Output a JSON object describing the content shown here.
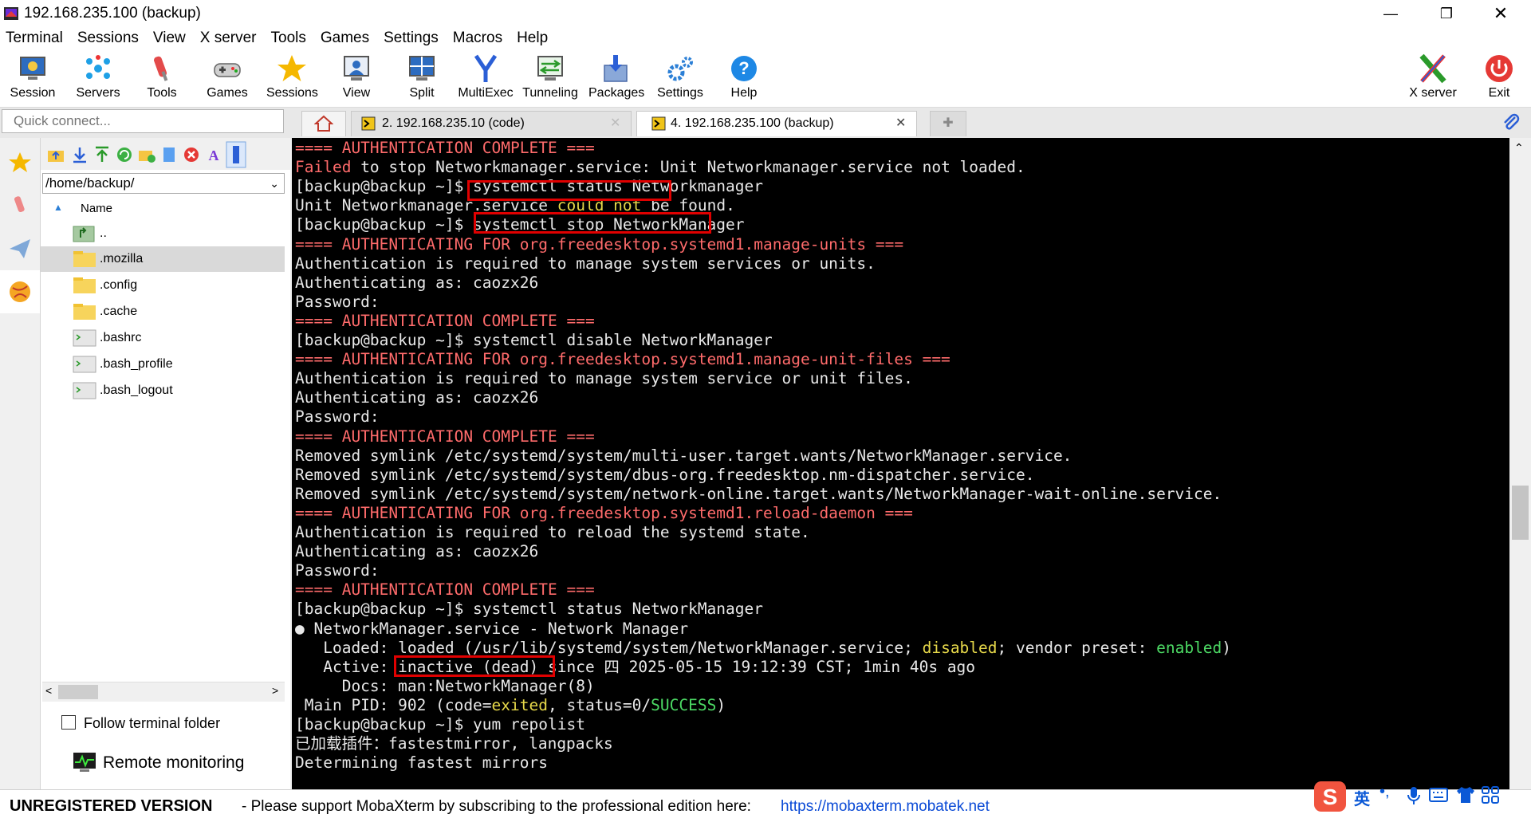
{
  "window": {
    "title": "192.168.235.100 (backup)",
    "minimize": "—",
    "maximize": "❐",
    "close": "✕"
  },
  "menu": [
    "Terminal",
    "Sessions",
    "View",
    "X server",
    "Tools",
    "Games",
    "Settings",
    "Macros",
    "Help"
  ],
  "toolbar": {
    "session": "Session",
    "servers": "Servers",
    "tools": "Tools",
    "games": "Games",
    "sessions": "Sessions",
    "view": "View",
    "split": "Split",
    "multiexec": "MultiExec",
    "tunneling": "Tunneling",
    "packages": "Packages",
    "settings": "Settings",
    "help": "Help",
    "xserver": "X server",
    "exit": "Exit"
  },
  "quick_connect": {
    "placeholder": "Quick connect..."
  },
  "tabs": [
    {
      "label": "2. 192.168.235.10 (code)",
      "active": false
    },
    {
      "label": "4. 192.168.235.100 (backup)",
      "active": true
    }
  ],
  "sidebar": {
    "path": "/home/backup/",
    "column_header": "Name",
    "files": [
      {
        "name": "..",
        "kind": "up"
      },
      {
        "name": ".mozilla",
        "kind": "folder",
        "selected": true
      },
      {
        "name": ".config",
        "kind": "folder"
      },
      {
        "name": ".cache",
        "kind": "folder"
      },
      {
        "name": ".bashrc",
        "kind": "file"
      },
      {
        "name": ".bash_profile",
        "kind": "file"
      },
      {
        "name": ".bash_logout",
        "kind": "file"
      }
    ],
    "follow_terminal_folder": "Follow terminal folder",
    "remote_monitoring": "Remote monitoring"
  },
  "terminal": {
    "lines": [
      [
        {
          "t": "==== AUTHENTICATION COMPLETE ===",
          "c": "red"
        }
      ],
      [
        {
          "t": "Failed",
          "c": "red"
        },
        {
          "t": " to stop Networkmanager.service: Unit Networkmanager.service not loaded."
        }
      ],
      [
        {
          "t": "[backup@backup ~]$ systemctl status Networkmanager"
        }
      ],
      [
        {
          "t": "Unit Networkmanager.service "
        },
        {
          "t": "could not",
          "c": "yellow"
        },
        {
          "t": " be found."
        }
      ],
      [
        {
          "t": "[backup@backup ~]$ systemctl stop NetworkManager"
        }
      ],
      [
        {
          "t": "==== AUTHENTICATING FOR org.freedesktop.systemd1.manage-units ===",
          "c": "red"
        }
      ],
      [
        {
          "t": "Authentication is required to manage system services or units."
        }
      ],
      [
        {
          "t": "Authenticating as: caozx26"
        }
      ],
      [
        {
          "t": "Password:"
        }
      ],
      [
        {
          "t": "==== AUTHENTICATION COMPLETE ===",
          "c": "red"
        }
      ],
      [
        {
          "t": "[backup@backup ~]$ systemctl disable NetworkManager"
        }
      ],
      [
        {
          "t": "==== AUTHENTICATING FOR org.freedesktop.systemd1.manage-unit-files ===",
          "c": "red"
        }
      ],
      [
        {
          "t": "Authentication is required to manage system service or unit files."
        }
      ],
      [
        {
          "t": "Authenticating as: caozx26"
        }
      ],
      [
        {
          "t": "Password:"
        }
      ],
      [
        {
          "t": "==== AUTHENTICATION COMPLETE ===",
          "c": "red"
        }
      ],
      [
        {
          "t": "Removed symlink /etc/systemd/system/multi-user.target.wants/NetworkManager.service."
        }
      ],
      [
        {
          "t": "Removed symlink /etc/systemd/system/dbus-org.freedesktop.nm-dispatcher.service."
        }
      ],
      [
        {
          "t": "Removed symlink /etc/systemd/system/network-online.target.wants/NetworkManager-wait-online.service."
        }
      ],
      [
        {
          "t": "==== AUTHENTICATING FOR org.freedesktop.systemd1.reload-daemon ===",
          "c": "red"
        }
      ],
      [
        {
          "t": "Authentication is required to reload the systemd state."
        }
      ],
      [
        {
          "t": "Authenticating as: caozx26"
        }
      ],
      [
        {
          "t": "Password:"
        }
      ],
      [
        {
          "t": "==== AUTHENTICATION COMPLETE ===",
          "c": "red"
        }
      ],
      [
        {
          "t": "[backup@backup ~]$ systemctl status NetworkManager"
        }
      ],
      [
        {
          "t": "● NetworkManager.service - Network Manager"
        }
      ],
      [
        {
          "t": "   Loaded: loaded (/usr/lib/systemd/system/NetworkManager.service; "
        },
        {
          "t": "disabled",
          "c": "yellow"
        },
        {
          "t": "; vendor preset: "
        },
        {
          "t": "enabled",
          "c": "green"
        },
        {
          "t": ")"
        }
      ],
      [
        {
          "t": "   Active: inactive (dead) since 四 2025-05-15 19:12:39 CST; 1min 40s ago"
        }
      ],
      [
        {
          "t": "     Docs: man:NetworkManager(8)"
        }
      ],
      [
        {
          "t": " Main PID: 902 (code="
        },
        {
          "t": "exited",
          "c": "yellow"
        },
        {
          "t": ", status=0/"
        },
        {
          "t": "SUCCESS",
          "c": "green"
        },
        {
          "t": ")"
        }
      ],
      [
        {
          "t": "[backup@backup ~]$ yum repolist"
        }
      ],
      [
        {
          "t": "已加载插件：fastestmirror, langpacks"
        }
      ],
      [
        {
          "t": "Determining fastest mirrors"
        }
      ]
    ]
  },
  "statusbar": {
    "unregistered": "UNREGISTERED VERSION",
    "support": "-  Please support MobaXterm by subscribing to the professional edition here:",
    "link": "https://mobaxterm.mobatek.net"
  },
  "ime": {
    "mode": "英"
  },
  "colors": {
    "terminal_bg": "#000000",
    "highlight": "#e00000",
    "accent": "#0a4ad6"
  }
}
